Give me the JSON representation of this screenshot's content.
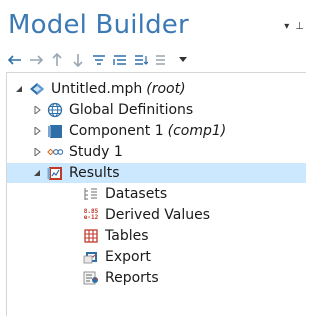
{
  "panel": {
    "title": "Model Builder",
    "controls": {
      "menu": "▾",
      "pin": "⊥"
    }
  },
  "toolbar": {
    "buttons": [
      "back",
      "forward",
      "up",
      "down",
      "show",
      "expand-sections",
      "collapse-sections",
      "options"
    ]
  },
  "tree": {
    "root": {
      "label": "Untitled.mph",
      "tag": "(root)"
    },
    "items": [
      {
        "label": "Global Definitions",
        "tag": ""
      },
      {
        "label": "Component 1",
        "tag": "(comp1)"
      },
      {
        "label": "Study 1",
        "tag": ""
      },
      {
        "label": "Results",
        "tag": ""
      },
      {
        "label": "Datasets",
        "tag": ""
      },
      {
        "label": "Derived Values",
        "tag": ""
      },
      {
        "label": "Tables",
        "tag": ""
      },
      {
        "label": "Export",
        "tag": ""
      },
      {
        "label": "Reports",
        "tag": ""
      }
    ],
    "derived_values_icon_text": "8.85 e-12"
  },
  "colors": {
    "title": "#3c7ab6",
    "selection": "#cce8ff",
    "accent_blue": "#2f6fa8"
  }
}
